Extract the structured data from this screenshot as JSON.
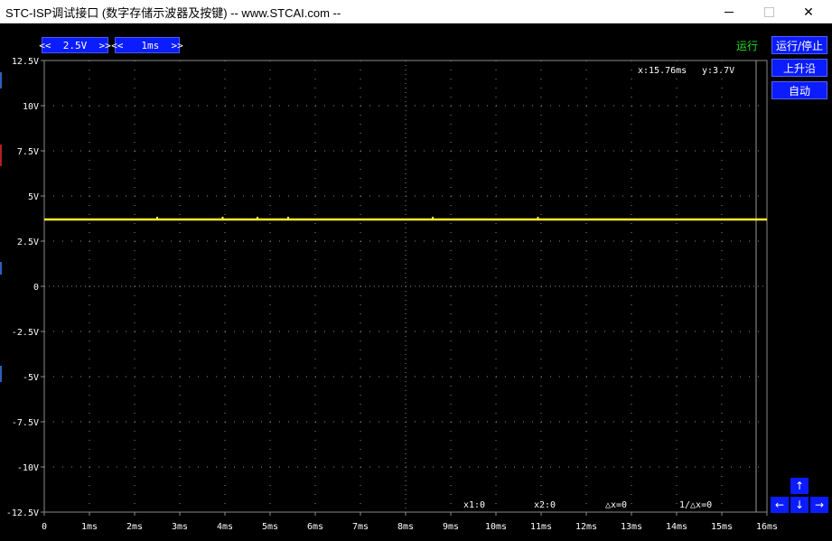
{
  "window": {
    "title": "STC-ISP调试接口 (数字存储示波器及按键) -- www.STCAI.com --",
    "minimize_icon": "minimize-icon",
    "maximize_icon": "maximize-icon",
    "close_icon": "close-icon",
    "close_glyph": "✕"
  },
  "toolbar": {
    "volt_control": "<<  2.5V  >>",
    "time_control": "<<   1ms  >>",
    "status": "运行"
  },
  "side_buttons": {
    "run_stop": "运行/停止",
    "rising_edge": "上升沿",
    "auto": "自动"
  },
  "nav": {
    "up": "↑",
    "left": "←",
    "down": "↓",
    "right": "→"
  },
  "readout": {
    "cursor_x": "x:15.76ms",
    "cursor_y": "y:3.7V",
    "x1": "x1:0",
    "x2": "x2:0",
    "dx": "△x=0",
    "inv_dx": "1/△x=0"
  },
  "colors": {
    "trace": "#ffee33",
    "button": "#0b1cff",
    "grid_dot": "#8a8a8a",
    "status": "#1fe11f",
    "cursor_line": "#9a9a9a"
  },
  "chart_data": {
    "type": "line",
    "y_tick_labels": [
      "12.5V",
      "10V",
      "7.5V",
      "5V",
      "2.5V",
      "0",
      "-2.5V",
      "-5V",
      "-7.5V",
      "-10V",
      "-12.5V"
    ],
    "y_ticks": [
      12.5,
      10,
      7.5,
      5,
      2.5,
      0,
      -2.5,
      -5,
      -7.5,
      -10,
      -12.5
    ],
    "x_tick_labels": [
      "0",
      "1ms",
      "2ms",
      "3ms",
      "4ms",
      "5ms",
      "6ms",
      "7ms",
      "8ms",
      "9ms",
      "10ms",
      "11ms",
      "12ms",
      "13ms",
      "14ms",
      "15ms",
      "16ms"
    ],
    "x_ticks": [
      0,
      1,
      2,
      3,
      4,
      5,
      6,
      7,
      8,
      9,
      10,
      11,
      12,
      13,
      14,
      15,
      16
    ],
    "xlim": [
      0,
      16
    ],
    "ylim": [
      -12.5,
      12.5
    ],
    "grid": true,
    "cursor_x_ms": 15.76,
    "series": [
      {
        "values_x": [
          0,
          2.5,
          4.0,
          4.75,
          5.4,
          8.0,
          8.6,
          10.9,
          16
        ],
        "values_y": [
          3.7,
          3.7,
          3.7,
          3.7,
          3.7,
          3.7,
          3.7,
          3.7,
          3.7
        ],
        "markers_x": [
          2.5,
          3.95,
          4.72,
          5.4,
          8.6,
          10.93
        ]
      }
    ]
  }
}
